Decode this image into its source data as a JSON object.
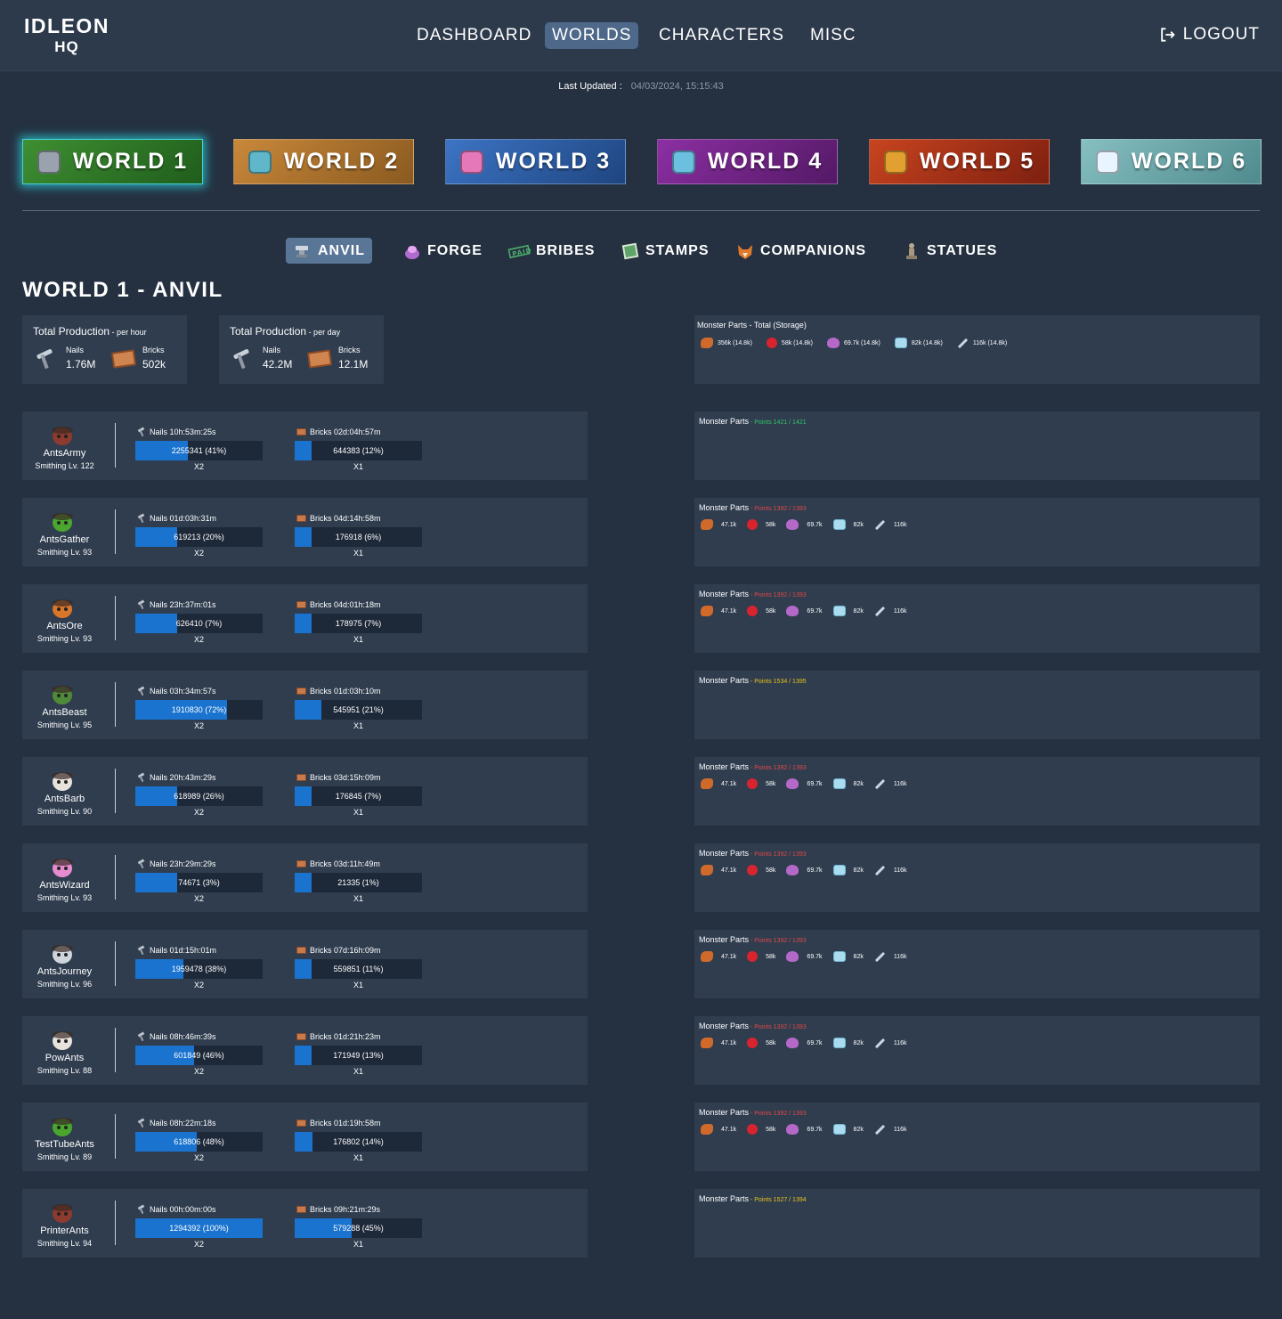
{
  "header": {
    "logo_line1": "IDLEON",
    "logo_line2": "HQ",
    "nav": [
      "DASHBOARD",
      "WORLDS",
      "CHARACTERS",
      "MISC"
    ],
    "logout": "LOGOUT"
  },
  "last_updated": {
    "label": "Last Updated :",
    "value": "04/03/2024, 15:15:43"
  },
  "worlds": [
    "WORLD 1",
    "WORLD 2",
    "WORLD 3",
    "WORLD 4",
    "WORLD 5",
    "WORLD 6"
  ],
  "world_colors": [
    "#2f7a2a",
    "#b8762e",
    "#2b5fa8",
    "#7a2590",
    "#b33218",
    "#6aa6a8"
  ],
  "subtabs": [
    "ANVIL",
    "FORGE",
    "BRIBES",
    "STAMPS",
    "COMPANIONS",
    "STATUES"
  ],
  "page_title": "WORLD 1 - ANVIL",
  "total_hour": {
    "title": "Total Production",
    "sub": " - per hour",
    "nails_label": "Nails",
    "nails": "1.76M",
    "bricks_label": "Bricks",
    "bricks": "502k"
  },
  "total_day": {
    "title": "Total Production",
    "sub": " - per day",
    "nails_label": "Nails",
    "nails": "42.2M",
    "bricks_label": "Bricks",
    "bricks": "12.1M"
  },
  "monster_total": {
    "title": "Monster Parts - Total (Storage)",
    "parts": [
      "356k (14.8k)",
      "58k (14.8k)",
      "69.7k (14.8k)",
      "82k (14.8k)",
      "116k (14.8k)"
    ]
  },
  "status_colors": {
    "green": "#35c46a",
    "red": "#e04848",
    "yellow": "#e8c21a"
  },
  "characters": [
    {
      "name": "AntsArmy",
      "level": "Smithing Lv. 122",
      "nails_time": "Nails  10h:53m:25s",
      "nails_bar": "2255341 (41%)",
      "nails_pct": 0.41,
      "nails_mult": "X2",
      "bricks_time": "Bricks  02d:04h:57m",
      "bricks_bar": "644383 (12%)",
      "bricks_pct": 0.12,
      "bricks_mult": "X1",
      "mp_label": "Monster Parts",
      "mp_points": " - Points 1421 / 1421",
      "mp_status": "green",
      "parts": []
    },
    {
      "name": "AntsGather",
      "level": "Smithing Lv. 93",
      "nails_time": "Nails  01d:03h:31m",
      "nails_bar": "619213 (20%)",
      "nails_pct": 0.2,
      "nails_mult": "X2",
      "bricks_time": "Bricks  04d:14h:58m",
      "bricks_bar": "176918 (6%)",
      "bricks_pct": 0.06,
      "bricks_mult": "X1",
      "mp_label": "Monster Parts",
      "mp_points": " - Points 1392 / 1393",
      "mp_status": "red",
      "parts": [
        "47.1k",
        "58k",
        "69.7k",
        "82k",
        "116k"
      ]
    },
    {
      "name": "AntsOre",
      "level": "Smithing Lv. 93",
      "nails_time": "Nails  23h:37m:01s",
      "nails_bar": "626410 (7%)",
      "nails_pct": 0.07,
      "nails_mult": "X2",
      "bricks_time": "Bricks  04d:01h:18m",
      "bricks_bar": "178975 (7%)",
      "bricks_pct": 0.07,
      "bricks_mult": "X1",
      "mp_label": "Monster Parts",
      "mp_points": " - Points 1392 / 1393",
      "mp_status": "red",
      "parts": [
        "47.1k",
        "58k",
        "69.7k",
        "82k",
        "116k"
      ]
    },
    {
      "name": "AntsBeast",
      "level": "Smithing Lv. 95",
      "nails_time": "Nails  03h:34m:57s",
      "nails_bar": "1910830 (72%)",
      "nails_pct": 0.72,
      "nails_mult": "X2",
      "bricks_time": "Bricks  01d:03h:10m",
      "bricks_bar": "545951 (21%)",
      "bricks_pct": 0.21,
      "bricks_mult": "X1",
      "mp_label": "Monster Parts",
      "mp_points": " - Points 1534 / 1395",
      "mp_status": "yellow",
      "parts": []
    },
    {
      "name": "AntsBarb",
      "level": "Smithing Lv. 90",
      "nails_time": "Nails  20h:43m:29s",
      "nails_bar": "618989 (26%)",
      "nails_pct": 0.26,
      "nails_mult": "X2",
      "bricks_time": "Bricks  03d:15h:09m",
      "bricks_bar": "176845 (7%)",
      "bricks_pct": 0.07,
      "bricks_mult": "X1",
      "mp_label": "Monster Parts",
      "mp_points": " - Points 1392 / 1393",
      "mp_status": "red",
      "parts": [
        "47.1k",
        "58k",
        "69.7k",
        "82k",
        "116k"
      ]
    },
    {
      "name": "AntsWizard",
      "level": "Smithing Lv. 93",
      "nails_time": "Nails  23h:29m:29s",
      "nails_bar": "74671 (3%)",
      "nails_pct": 0.03,
      "nails_mult": "X2",
      "bricks_time": "Bricks  03d:11h:49m",
      "bricks_bar": "21335 (1%)",
      "bricks_pct": 0.01,
      "bricks_mult": "X1",
      "mp_label": "Monster Parts",
      "mp_points": " - Points 1392 / 1393",
      "mp_status": "red",
      "parts": [
        "47.1k",
        "58k",
        "69.7k",
        "82k",
        "116k"
      ]
    },
    {
      "name": "AntsJourney",
      "level": "Smithing Lv. 96",
      "nails_time": "Nails  01d:15h:01m",
      "nails_bar": "1959478 (38%)",
      "nails_pct": 0.38,
      "nails_mult": "X2",
      "bricks_time": "Bricks  07d:16h:09m",
      "bricks_bar": "559851 (11%)",
      "bricks_pct": 0.11,
      "bricks_mult": "X1",
      "mp_label": "Monster Parts",
      "mp_points": " - Points 1392 / 1393",
      "mp_status": "red",
      "parts": [
        "47.1k",
        "58k",
        "69.7k",
        "82k",
        "116k"
      ]
    },
    {
      "name": "PowAnts",
      "level": "Smithing Lv. 88",
      "nails_time": "Nails  08h:46m:39s",
      "nails_bar": "601849 (46%)",
      "nails_pct": 0.46,
      "nails_mult": "X2",
      "bricks_time": "Bricks  01d:21h:23m",
      "bricks_bar": "171949 (13%)",
      "bricks_pct": 0.13,
      "bricks_mult": "X1",
      "mp_label": "Monster Parts",
      "mp_points": " - Points 1392 / 1393",
      "mp_status": "red",
      "parts": [
        "47.1k",
        "58k",
        "69.7k",
        "82k",
        "116k"
      ]
    },
    {
      "name": "TestTubeAnts",
      "level": "Smithing Lv. 89",
      "nails_time": "Nails  08h:22m:18s",
      "nails_bar": "618806 (48%)",
      "nails_pct": 0.48,
      "nails_mult": "X2",
      "bricks_time": "Bricks  01d:19h:58m",
      "bricks_bar": "176802 (14%)",
      "bricks_pct": 0.14,
      "bricks_mult": "X1",
      "mp_label": "Monster Parts",
      "mp_points": " - Points 1392 / 1393",
      "mp_status": "red",
      "parts": [
        "47.1k",
        "58k",
        "69.7k",
        "82k",
        "116k"
      ]
    },
    {
      "name": "PrinterAnts",
      "level": "Smithing Lv. 94",
      "nails_time": "Nails  00h:00m:00s",
      "nails_bar": "1294392 (100%)",
      "nails_pct": 1.0,
      "nails_mult": "X2",
      "bricks_time": "Bricks  09h:21m:29s",
      "bricks_bar": "579288 (45%)",
      "bricks_pct": 0.45,
      "bricks_mult": "X1",
      "mp_label": "Monster Parts",
      "mp_points": " - Points 1527 / 1394",
      "mp_status": "yellow",
      "parts": []
    }
  ]
}
